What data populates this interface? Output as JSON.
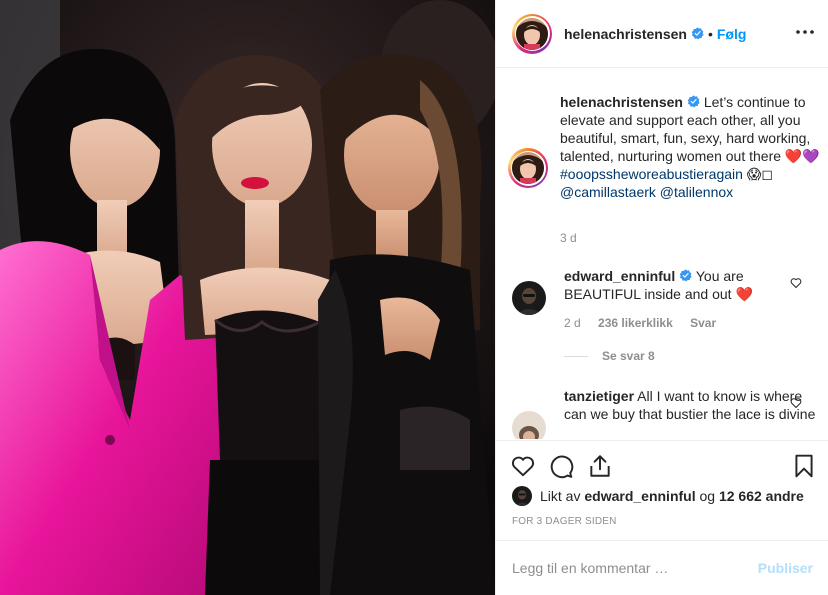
{
  "photo": {
    "alt": ""
  },
  "header": {
    "username": "helenachristensen",
    "separator": "•",
    "follow_label": "Følg"
  },
  "caption": {
    "username": "helenachristensen",
    "text": "Let’s continue to elevate and support each other, all you beautiful, smart, fun, sexy, hard working, talented, nurturing women out there ❤️💜",
    "hashtag": "#ooopssheworeabustieragain",
    "emoji_tail": "😱◻",
    "mention1": "@camillastaerk",
    "mention2": "@talilennox",
    "age": "3 d"
  },
  "comments": [
    {
      "username": "edward_enninful",
      "text": "You are BEAUTIFUL inside and out ❤️",
      "age": "2 d",
      "likes": "236 likerklikk",
      "reply": "Svar",
      "view_replies": "Se svar 8"
    },
    {
      "username": "tanzietiger",
      "text": "All I want to know is where can we buy that bustier the lace is divine"
    }
  ],
  "likes": {
    "prefix": "Likt av",
    "user": "edward_enninful",
    "middle": "og",
    "others": "12 662 andre"
  },
  "date": "FOR 3 DAGER SIDEN",
  "add_comment": {
    "placeholder": "Legg til en kommentar …",
    "publish_label": "Publiser"
  },
  "colors": {
    "accent": "#0095f6",
    "link": "#00376b",
    "muted": "#8e8e8e",
    "publish_disabled": "#b2dffc",
    "heart": "#ed4956"
  }
}
